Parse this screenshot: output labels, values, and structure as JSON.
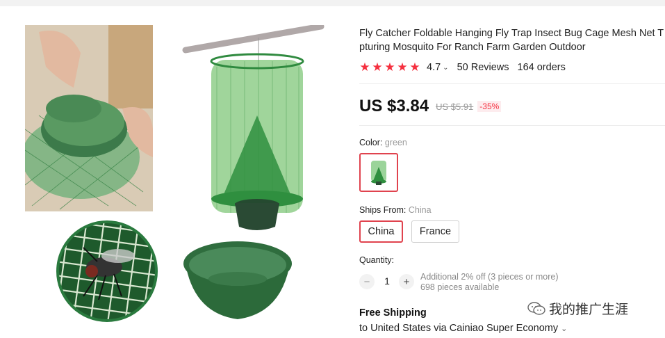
{
  "product": {
    "title_lines": [
      "Fly Catcher Foldable Hanging Fly Trap Insect Bug Cage Mesh Net T",
      "pturing Mosquito For Ranch Farm Garden Outdoor"
    ],
    "rating": "4.7",
    "stars": 5,
    "reviews": "50 Reviews",
    "orders": "164 orders",
    "price": "US $3.84",
    "original_price": "US $5.91",
    "discount": "-35%"
  },
  "options": {
    "color_label": "Color:",
    "color_value": "green",
    "ships_from_label": "Ships From:",
    "ships_from_value": "China",
    "ship_options": [
      "China",
      "France"
    ]
  },
  "quantity": {
    "label": "Quantity:",
    "minus": "−",
    "value": "1",
    "plus": "+",
    "note_line1": "Additional 2% off (3 pieces or more)",
    "note_line2": "698 pieces available"
  },
  "shipping": {
    "headline": "Free Shipping",
    "detail": "to United States via Cainiao Super Economy"
  },
  "watermark": "我的推广生涯",
  "colors": {
    "accent": "#f5303f",
    "selected_border": "#e0434e",
    "mesh_green": "#3f9a58",
    "bowl_green": "#3c7a4a"
  }
}
